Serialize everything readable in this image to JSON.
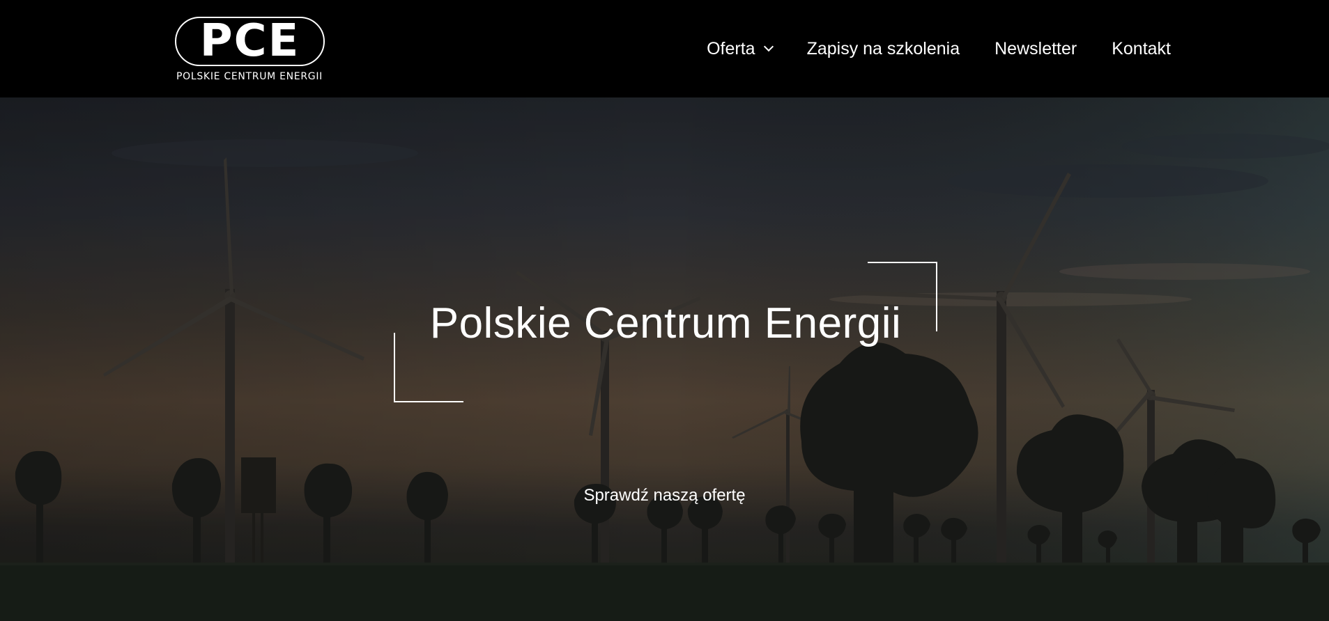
{
  "header": {
    "logo": {
      "mark": "PCE",
      "subtitle": "POLSKIE CENTRUM ENERGII"
    },
    "nav": [
      {
        "label": "Oferta",
        "has_dropdown": true
      },
      {
        "label": "Zapisy na szkolenia"
      },
      {
        "label": "Newsletter"
      },
      {
        "label": "Kontakt"
      }
    ]
  },
  "hero": {
    "title": "Polskie Centrum Energii",
    "cta": "Sprawdź naszą ofertę",
    "image": "wind-turbines-at-dusk",
    "colors": {
      "header_background": "#000000",
      "text": "#ffffff",
      "bracket": "#ffffff"
    }
  }
}
